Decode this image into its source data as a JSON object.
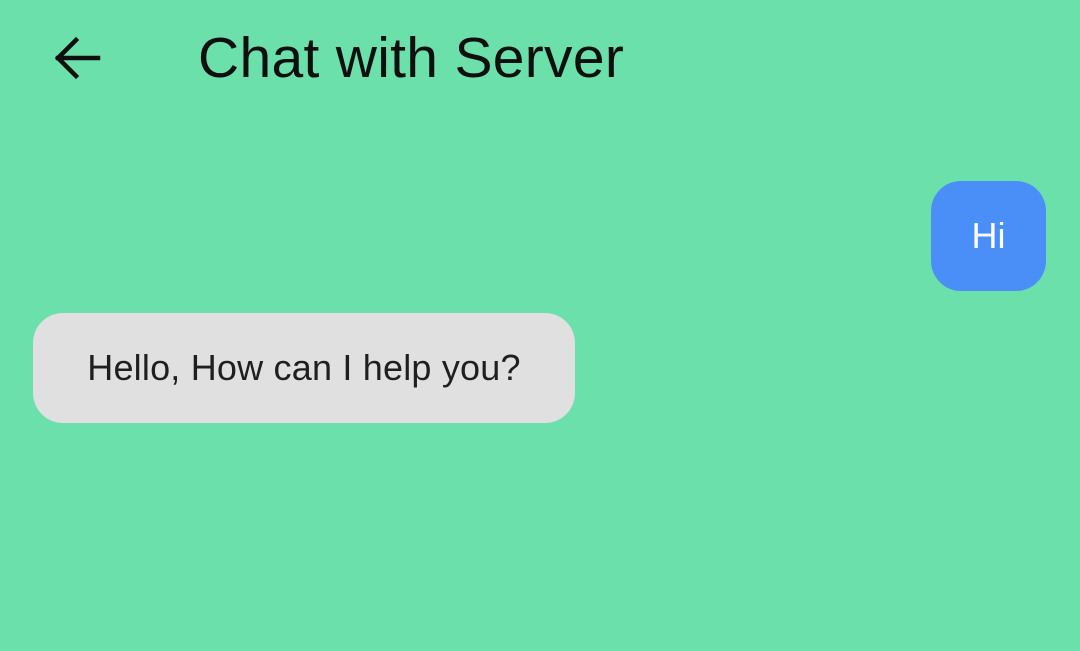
{
  "app_bar": {
    "title": "Chat with Server",
    "back_icon": "arrow-left-icon"
  },
  "messages": [
    {
      "sender": "user",
      "text": "Hi"
    },
    {
      "sender": "server",
      "text": "Hello, How can I help you?"
    }
  ],
  "colors": {
    "background": "#6be0ab",
    "user_bubble": "#4a8ff8",
    "server_bubble": "#e0e0e0"
  }
}
